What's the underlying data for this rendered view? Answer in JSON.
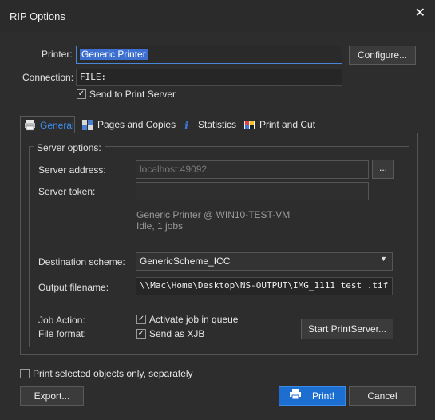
{
  "window": {
    "title": "RIP Options"
  },
  "printer": {
    "label": "Printer:",
    "value": "Generic Printer",
    "configure_label": "Configure...",
    "connection_label": "Connection:",
    "connection_value": "FILE:",
    "send_to_server": {
      "label": "Send to Print Server",
      "checked": true
    }
  },
  "tabs": [
    {
      "label": "General",
      "active": true
    },
    {
      "label": "Pages and Copies",
      "active": false
    },
    {
      "label": "Statistics",
      "active": false
    },
    {
      "label": "Print and Cut",
      "active": false
    }
  ],
  "server": {
    "group_title": "Server options:",
    "address_label": "Server address:",
    "address_value": "localhost:49092",
    "browse_label": "...",
    "token_label": "Server token:",
    "token_value": "",
    "status_line1": "Generic Printer @ WIN10-TEST-VM",
    "status_line2": "Idle, 1 jobs",
    "destination_label": "Destination scheme:",
    "destination_value": "GenericScheme_ICC",
    "output_label": "Output filename:",
    "output_value": "\\\\Mac\\Home\\Desktop\\NS-OUTPUT\\IMG_1111 test .tif",
    "job_action_label": "Job Action:",
    "file_format_label": "File format:",
    "activate_job": {
      "label": "Activate job in queue",
      "checked": true
    },
    "send_xjb": {
      "label": "Send as XJB",
      "checked": true
    },
    "start_label": "Start PrintServer..."
  },
  "footer": {
    "print_selected": {
      "label": "Print selected objects only, separately",
      "checked": false
    },
    "export_label": "Export...",
    "print_label": "Print!",
    "cancel_label": "Cancel"
  },
  "colors": {
    "accent": "#3d8ef0",
    "primary_button": "#1c6fd1",
    "selection": "#3d6fd1"
  }
}
